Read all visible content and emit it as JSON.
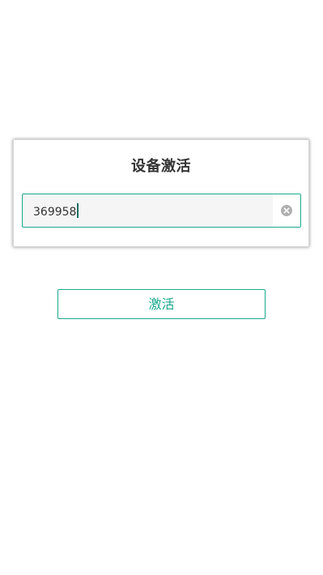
{
  "dialog": {
    "title": "设备激活",
    "code_input": {
      "value": "369958"
    },
    "clear_icon": "clear-circle-icon"
  },
  "actions": {
    "activate_label": "激活"
  },
  "colors": {
    "accent": "#1aa88f",
    "title_text": "#333333",
    "input_background": "#f5f5f5"
  }
}
